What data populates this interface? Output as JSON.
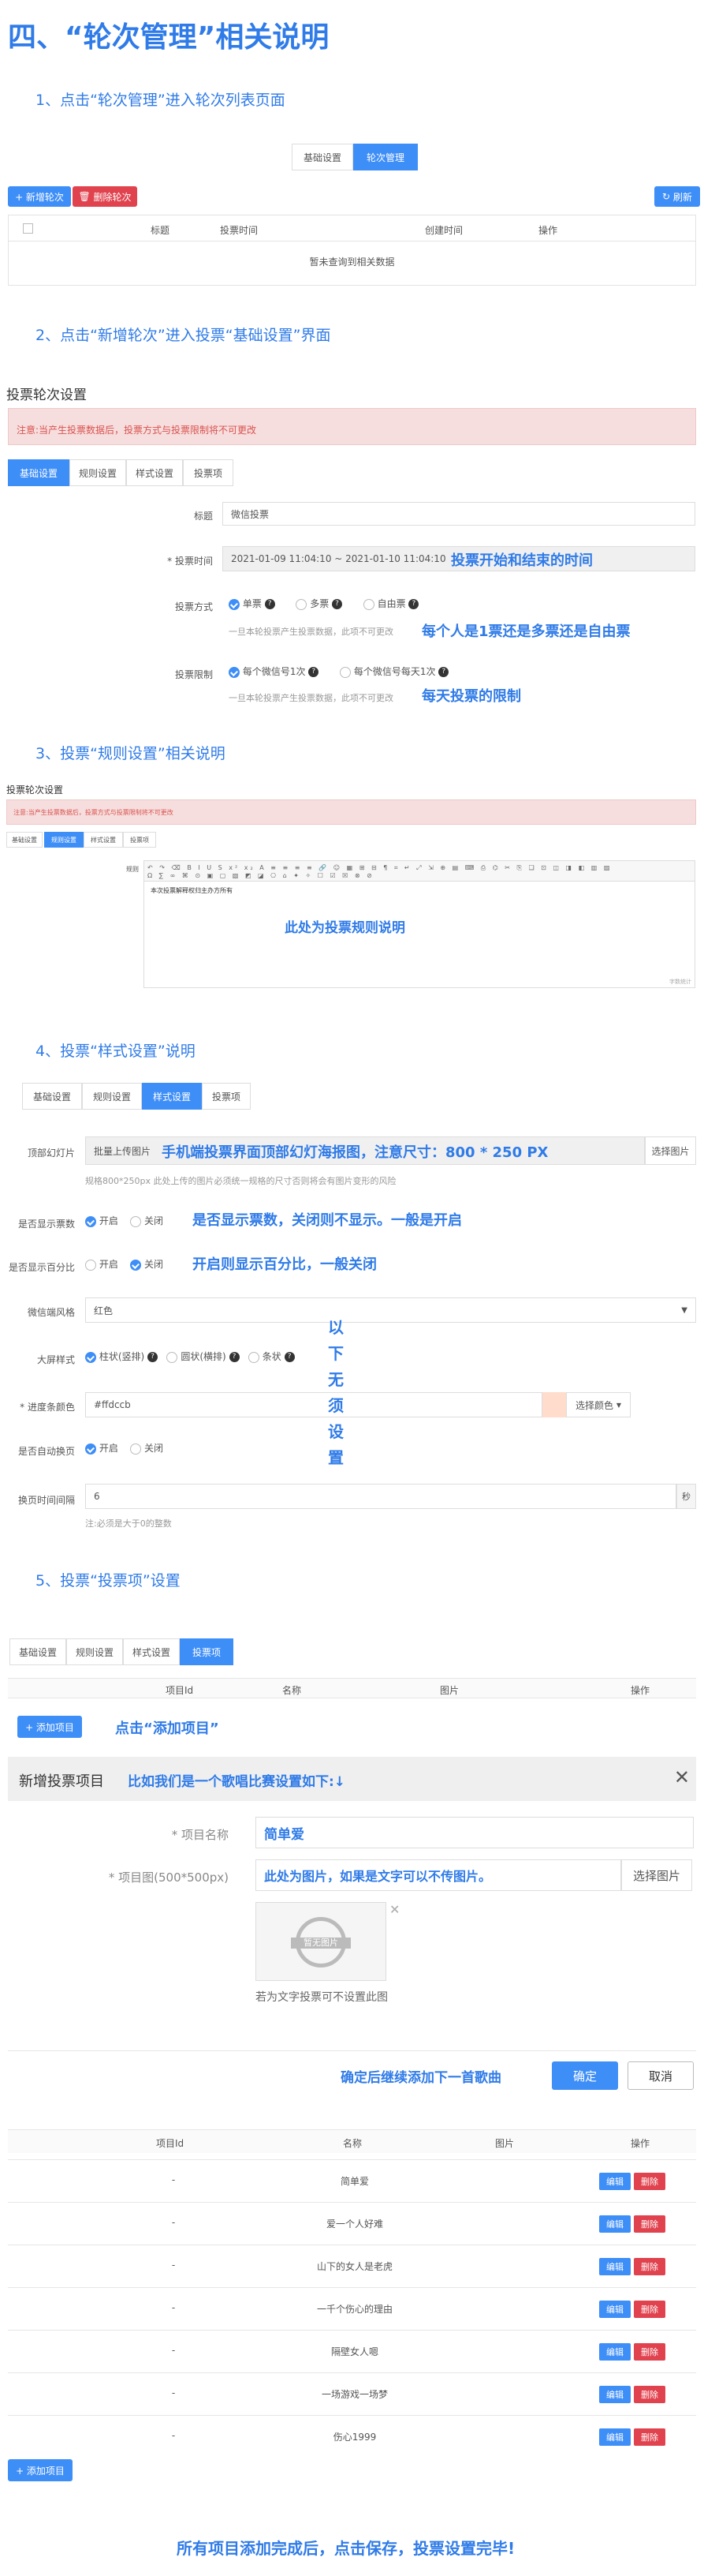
{
  "title": "四、“轮次管理”相关说明",
  "s1": {
    "heading": "1、点击“轮次管理”进入轮次列表页面",
    "tabs": [
      "基础设置",
      "轮次管理"
    ],
    "add": "+ 新增轮次",
    "del": "删除轮次",
    "refresh": "刷新",
    "cols": [
      "标题",
      "投票时间",
      "创建时间",
      "操作"
    ],
    "empty": "暂未查询到相关数据"
  },
  "s2": {
    "heading": "2、点击“新增轮次”进入投票“基础设置”界面",
    "page_title": "投票轮次设置",
    "warning": "注意:当产生投票数据后，投票方式与投票限制将不可更改",
    "tabs": [
      "基础设置",
      "规则设置",
      "样式设置",
      "投票项"
    ],
    "label_title": "标题",
    "title_value": "微信投票",
    "label_time": "* 投票时间",
    "time_value": "2021-01-09 11:04:10 ~ 2021-01-10 11:04:10",
    "note_time": "投票开始和结束的时间",
    "label_mode": "投票方式",
    "mode_opts": [
      "单票",
      "多票",
      "自由票"
    ],
    "mode_hint": "一旦本轮投票产生投票数据，此项不可更改",
    "note_mode": "每个人是1票还是多票还是自由票",
    "label_limit": "投票限制",
    "limit_opts": [
      "每个微信号1次",
      "每个微信号每天1次"
    ],
    "limit_hint": "一旦本轮投票产生投票数据，此项不可更改",
    "note_limit": "每天投票的限制"
  },
  "s3": {
    "heading": "3、投票“规则设置”相关说明",
    "page_title": "投票轮次设置",
    "warning": "注意:当产生投票数据后，投票方式与投票限制将不可更改",
    "tabs": [
      "基础设置",
      "规则设置",
      "样式设置",
      "投票项"
    ],
    "label": "规则",
    "editor_text": "本次投票解释权归主办方所有",
    "note": "此处为投票规则说明",
    "count": "字数统计"
  },
  "s4": {
    "heading": "4、投票“样式设置”说明",
    "tabs": [
      "基础设置",
      "规则设置",
      "样式设置",
      "投票项"
    ],
    "label_img": "顶部幻灯片",
    "img_placeholder": "批量上传图片",
    "img_btn": "选择图片",
    "note_img": "手机端投票界面顶部幻灯海报图，注意尺寸：800 * 250 PX",
    "img_hint": "规格800*250px 此处上传的图片必须统一规格的尺寸否则将会有图片变形的风险",
    "label_count": "是否显示票数",
    "on": "开启",
    "off": "关闭",
    "note_count": "是否显示票数，关闭则不显示。一般是开启",
    "label_pct": "是否显示百分比",
    "note_pct": "开启则显示百分比，一般关闭",
    "label_theme": "微信端风格",
    "theme_value": "红色",
    "label_chart": "大屏样式",
    "chart_opts": [
      "柱状(竖排)",
      "圆状(横排)",
      "条状"
    ],
    "label_bar": "* 进度条颜色",
    "bar_value": "#ffdccb",
    "bar_color": "#ffdccb",
    "bar_btn": "选择颜色",
    "label_flip": "是否自动换页",
    "label_interval": "换页时间间隔",
    "interval_value": "6",
    "interval_unit": "秒",
    "interval_hint": "注:必须是大于0的整数",
    "note_skip": "以下无须设置"
  },
  "s5": {
    "heading": "5、投票“投票项”设置",
    "tabs": [
      "基础设置",
      "规则设置",
      "样式设置",
      "投票项"
    ],
    "cols": [
      "项目Id",
      "名称",
      "图片",
      "操作"
    ],
    "add": "+ 添加项目",
    "note_add": "点击“添加项目”",
    "modal_title": "新增投票项目",
    "modal_note": "比如我们是一个歌唱比赛设置如下:↓",
    "label_name": "* 项目名称",
    "name_value": "简单爱",
    "label_pic": "* 项目图(500*500px)",
    "pic_note": "此处为图片，如果是文字可以不传图片。",
    "pic_btn": "选择图片",
    "no_img": "暂无图片",
    "pic_hint": "若为文字投票可不设置此图",
    "confirm_note": "确定后继续添加下一首歌曲",
    "ok": "确定",
    "cancel": "取消",
    "edit": "编辑",
    "del": "删除",
    "rows": [
      {
        "id": "-",
        "name": "简单爱"
      },
      {
        "id": "-",
        "name": "爱一个人好难"
      },
      {
        "id": "-",
        "name": "山下的女人是老虎"
      },
      {
        "id": "-",
        "name": "一千个伤心的理由"
      },
      {
        "id": "-",
        "name": "隔壁女人嗯"
      },
      {
        "id": "-",
        "name": "一场游戏一场梦"
      },
      {
        "id": "-",
        "name": "伤心1999"
      }
    ],
    "final": "所有项目添加完成后，点击保存，投票设置完毕!"
  }
}
